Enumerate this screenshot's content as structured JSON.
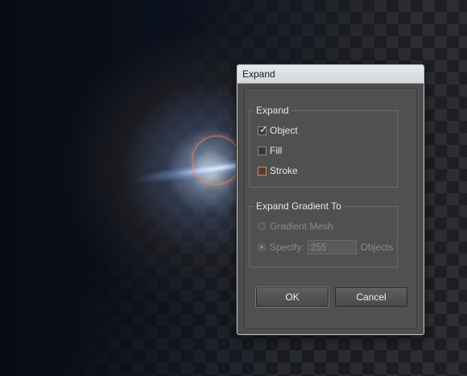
{
  "dialog": {
    "title": "Expand",
    "expand_group": {
      "legend": "Expand",
      "options": [
        {
          "label": "Object",
          "checked": true
        },
        {
          "label": "Fill",
          "checked": false
        },
        {
          "label": "Stroke",
          "checked": false,
          "focused": true
        }
      ]
    },
    "gradient_group": {
      "legend": "Expand Gradient To",
      "gradient_mesh_label": "Gradient Mesh",
      "specify_label": "Specify:",
      "specify_value": "255",
      "objects_label": "Objects",
      "selected": "Specify"
    },
    "buttons": {
      "ok": "OK",
      "cancel": "Cancel"
    }
  },
  "colors": {
    "dialog_bg": "#4d4d4d",
    "focus_accent": "#e08a3c",
    "titlebar": "#dbe0e6"
  }
}
